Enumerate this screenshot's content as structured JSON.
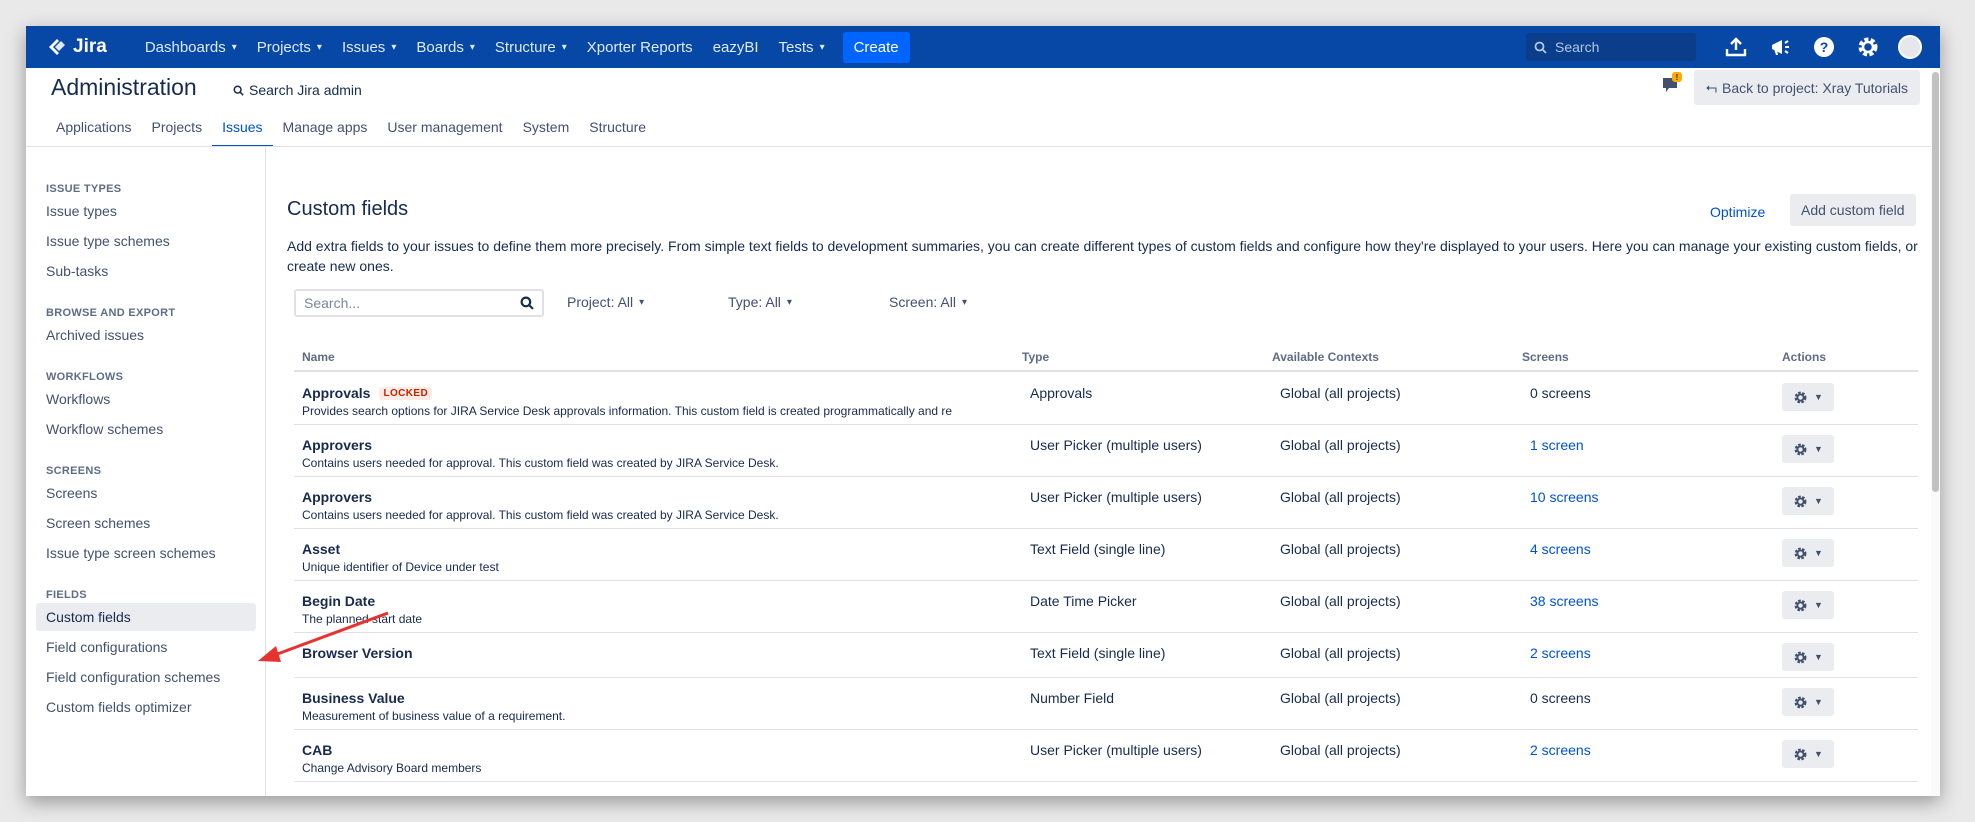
{
  "topnav": {
    "logo_text": "Jira",
    "items": [
      {
        "label": "Dashboards",
        "dropdown": true
      },
      {
        "label": "Projects",
        "dropdown": true
      },
      {
        "label": "Issues",
        "dropdown": true
      },
      {
        "label": "Boards",
        "dropdown": true
      },
      {
        "label": "Structure",
        "dropdown": true
      },
      {
        "label": "Xporter Reports",
        "dropdown": false
      },
      {
        "label": "eazyBI",
        "dropdown": false
      },
      {
        "label": "Tests",
        "dropdown": true
      }
    ],
    "create_label": "Create",
    "search_placeholder": "Search",
    "icons": [
      "upload-icon",
      "megaphone-icon",
      "help-icon",
      "gear-icon",
      "avatar"
    ]
  },
  "admin": {
    "title": "Administration",
    "search_label": "Search Jira admin",
    "back_label": "Back to project: Xray Tutorials",
    "notification_count": "!",
    "tabs": [
      "Applications",
      "Projects",
      "Issues",
      "Manage apps",
      "User management",
      "System",
      "Structure"
    ],
    "active_tab": "Issues"
  },
  "sidebar": {
    "sections": [
      {
        "heading": "ISSUE TYPES",
        "items": [
          "Issue types",
          "Issue type schemes",
          "Sub-tasks"
        ]
      },
      {
        "heading": "BROWSE AND EXPORT",
        "items": [
          "Archived issues"
        ]
      },
      {
        "heading": "WORKFLOWS",
        "items": [
          "Workflows",
          "Workflow schemes"
        ]
      },
      {
        "heading": "SCREENS",
        "items": [
          "Screens",
          "Screen schemes",
          "Issue type screen schemes"
        ]
      },
      {
        "heading": "FIELDS",
        "items": [
          "Custom fields",
          "Field configurations",
          "Field configuration schemes",
          "Custom fields optimizer"
        ]
      }
    ],
    "active_item": "Custom fields"
  },
  "main": {
    "title": "Custom fields",
    "optimize_label": "Optimize",
    "add_label": "Add custom field",
    "description": "Add extra fields to your issues to define them more precisely. From simple text fields to development summaries, you can create different types of custom fields and configure how they're displayed to your users. Here you can manage your existing custom fields, or create new ones.",
    "filters": {
      "search_placeholder": "Search...",
      "project": "Project: All",
      "type": "Type: All",
      "screen": "Screen: All"
    },
    "columns": [
      "Name",
      "Type",
      "Available Contexts",
      "Screens",
      "Actions"
    ],
    "rows": [
      {
        "name": "Approvals",
        "locked": "LOCKED",
        "desc": "Provides search options for JIRA Service Desk approvals information. This custom field is created programmatically and re",
        "type": "Approvals",
        "context": "Global (all projects)",
        "screens": "0 screens",
        "screens_link": false
      },
      {
        "name": "Approvers",
        "locked": "",
        "desc": "Contains users needed for approval. This custom field was created by JIRA Service Desk.",
        "type": "User Picker (multiple users)",
        "context": "Global (all projects)",
        "screens": "1 screen",
        "screens_link": true
      },
      {
        "name": "Approvers",
        "locked": "",
        "desc": "Contains users needed for approval. This custom field was created by JIRA Service Desk.",
        "type": "User Picker (multiple users)",
        "context": "Global (all projects)",
        "screens": "10 screens",
        "screens_link": true
      },
      {
        "name": "Asset",
        "locked": "",
        "desc": "Unique identifier of Device under test",
        "type": "Text Field (single line)",
        "context": "Global (all projects)",
        "screens": "4 screens",
        "screens_link": true
      },
      {
        "name": "Begin Date",
        "locked": "",
        "desc": "The planned start date",
        "type": "Date Time Picker",
        "context": "Global (all projects)",
        "screens": "38 screens",
        "screens_link": true
      },
      {
        "name": "Browser Version",
        "locked": "",
        "desc": "",
        "type": "Text Field (single line)",
        "context": "Global (all projects)",
        "screens": "2 screens",
        "screens_link": true
      },
      {
        "name": "Business Value",
        "locked": "",
        "desc": "Measurement of business value of a requirement.",
        "type": "Number Field",
        "context": "Global (all projects)",
        "screens": "0 screens",
        "screens_link": false
      },
      {
        "name": "CAB",
        "locked": "",
        "desc": "Change Advisory Board members",
        "type": "User Picker (multiple users)",
        "context": "Global (all projects)",
        "screens": "2 screens",
        "screens_link": true
      }
    ]
  },
  "colors": {
    "nav_bg": "#0747a6",
    "link": "#0052cc",
    "create_btn": "#0065ff",
    "arrow": "#e8322f"
  }
}
